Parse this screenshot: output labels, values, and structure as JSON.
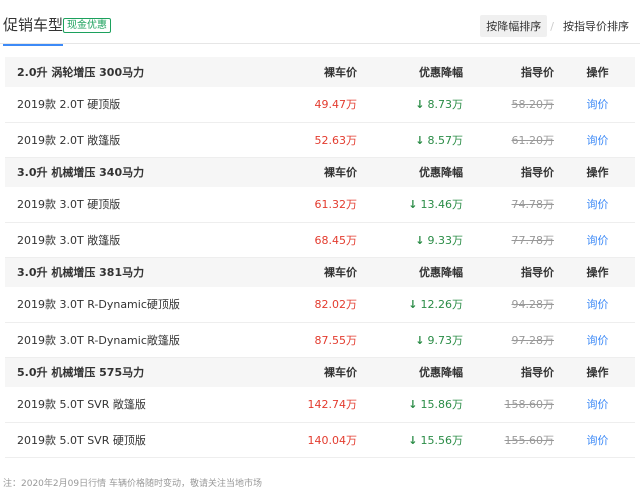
{
  "header": {
    "title": "促销车型",
    "tag": "现金优惠",
    "sort_buttons": [
      "按降幅排序",
      "按指导价排序"
    ],
    "sort_separator": "/"
  },
  "columns": {
    "price": "裸车价",
    "discount": "优惠降幅",
    "guide": "指导价",
    "op": "操作"
  },
  "groups": [
    {
      "name": "2.0升 涡轮增压 300马力",
      "rows": [
        {
          "name": "2019款 2.0T 硬顶版",
          "price": "49.47万",
          "discount": "8.73万",
          "guide": "58.20万",
          "action": "询价"
        },
        {
          "name": "2019款 2.0T 敞篷版",
          "price": "52.63万",
          "discount": "8.57万",
          "guide": "61.20万",
          "action": "询价"
        }
      ]
    },
    {
      "name": "3.0升 机械增压 340马力",
      "rows": [
        {
          "name": "2019款 3.0T 硬顶版",
          "price": "61.32万",
          "discount": "13.46万",
          "guide": "74.78万",
          "action": "询价"
        },
        {
          "name": "2019款 3.0T 敞篷版",
          "price": "68.45万",
          "discount": "9.33万",
          "guide": "77.78万",
          "action": "询价"
        }
      ]
    },
    {
      "name": "3.0升 机械增压 381马力",
      "rows": [
        {
          "name": "2019款 3.0T R-Dynamic硬顶版",
          "price": "82.02万",
          "discount": "12.26万",
          "guide": "94.28万",
          "action": "询价"
        },
        {
          "name": "2019款 3.0T R-Dynamic敞篷版",
          "price": "87.55万",
          "discount": "9.73万",
          "guide": "97.28万",
          "action": "询价"
        }
      ]
    },
    {
      "name": "5.0升 机械增压 575马力",
      "rows": [
        {
          "name": "2019款 5.0T SVR 敞篷版",
          "price": "142.74万",
          "discount": "15.86万",
          "guide": "158.60万",
          "action": "询价"
        },
        {
          "name": "2019款 5.0T SVR 硬顶版",
          "price": "140.04万",
          "discount": "15.56万",
          "guide": "155.60万",
          "action": "询价"
        }
      ]
    }
  ],
  "footer": "注：2020年2月09日行情 车辆价格随时变动，敬请关注当地市场",
  "colors": {
    "price": "#e33b2e",
    "discount": "#2a8c46",
    "link": "#3d8af7",
    "tag": "#1ca15d",
    "accent": "#3d8af7"
  },
  "icons": {
    "discount_arrow": "down-arrow-icon"
  }
}
